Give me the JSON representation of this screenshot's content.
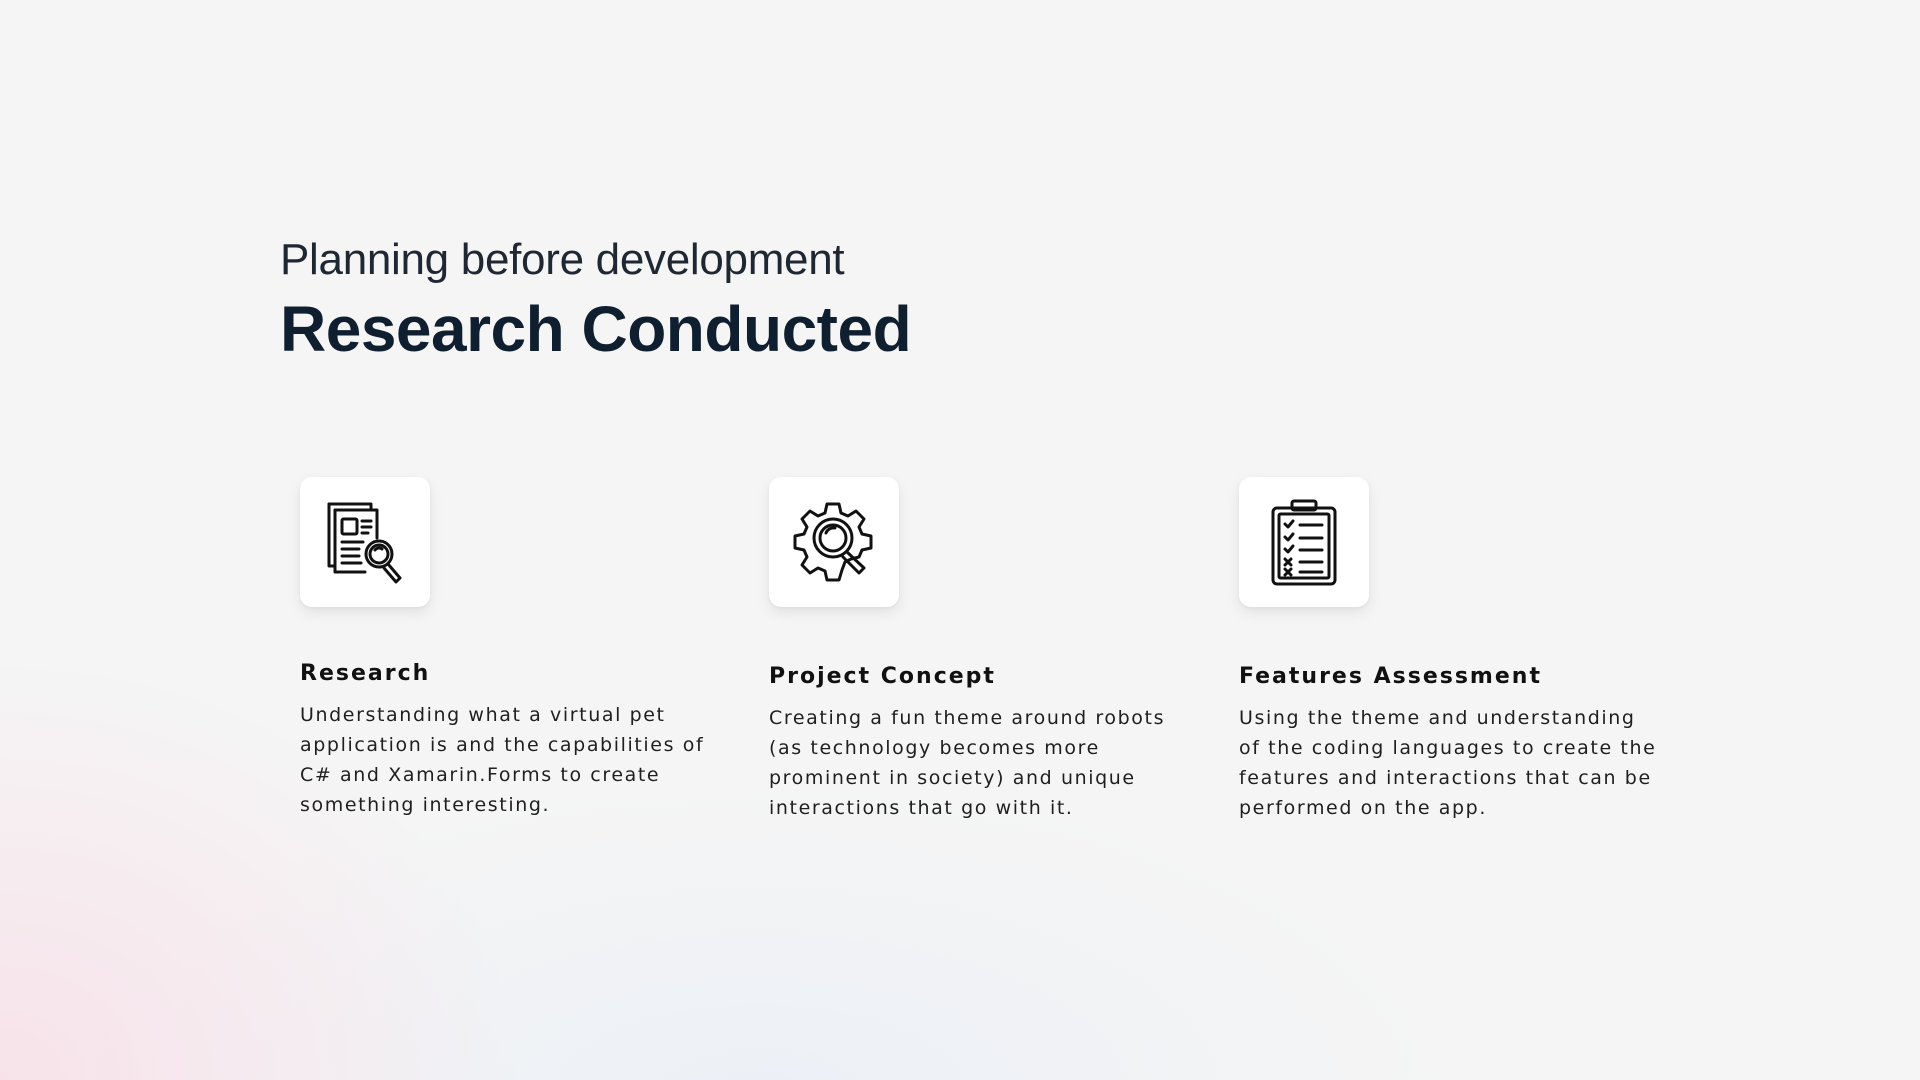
{
  "header": {
    "subtitle": "Planning before development",
    "title": "Research Conducted"
  },
  "cards": [
    {
      "icon": "document-search-icon",
      "title": "Research",
      "text": "Understanding what a virtual pet application is and the capabilities of C# and Xamarin.Forms to create something interesting."
    },
    {
      "icon": "gear-search-icon",
      "title": "Project Concept",
      "text": "Creating a fun theme around robots (as technology becomes more prominent in society) and unique interactions that go with it."
    },
    {
      "icon": "clipboard-checklist-icon",
      "title": "Features Assessment",
      "text": "Using the theme and understanding of the coding languages to create the features and interactions that can be performed on the app."
    }
  ],
  "colors": {
    "background": "#f5f5f5",
    "title": "#0f1f30",
    "text": "#1f1f1f",
    "icon": "#111111",
    "card": "#ffffff"
  }
}
